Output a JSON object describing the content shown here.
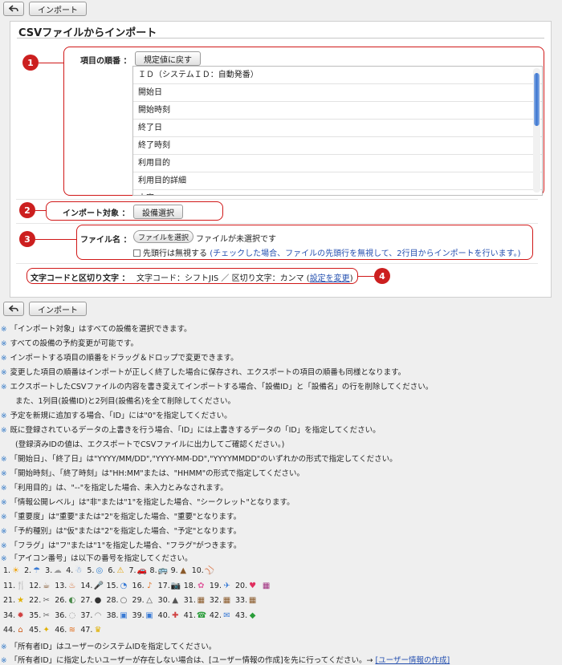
{
  "toolbar_top": {
    "back_icon": "back-arrow-icon",
    "import_label": "インポート"
  },
  "panel": {
    "title": "CSVファイルからインポート",
    "order": {
      "label": "項目の順番 ：",
      "reset_button": "規定値に戻す",
      "items": [
        "ＩＤ（システムＩＤ：自動発番）",
        "開始日",
        "開始時刻",
        "終了日",
        "終了時刻",
        "利用目的",
        "利用目的詳細",
        "内容"
      ]
    },
    "target": {
      "label": "インポート対象 ：",
      "button": "設備選択"
    },
    "file": {
      "label": "ファイル名 ：",
      "choose_button": "ファイルを選択",
      "status": "ファイルが未選択です",
      "checkbox_label": "先頭行は無視する",
      "checkbox_note": "(チェックした場合、ファイルの先頭行を無視して、2行目からインポートを行います。)"
    },
    "encoding": {
      "label": "文字コードと区切り文字 ：",
      "value": "文字コード：シフトJIS ／ 区切り文字：カンマ (",
      "link": "設定を変更",
      "close": ")"
    },
    "badges": [
      "1",
      "2",
      "3",
      "4"
    ]
  },
  "toolbar_bottom": {
    "back_icon": "back-arrow-icon",
    "import_label": "インポート"
  },
  "notes": [
    "「インポート対象」はすべての設備を選択できます。",
    "すべての設備の予約変更が可能です。",
    "インポートする項目の順番をドラッグ＆ドロップで変更できます。",
    "変更した項目の順番はインポートが正しく終了した場合に保存され、エクスポートの項目の順番も同様となります。",
    "エクスポートしたCSVファイルの内容を書き変えてインポートする場合、「設備ID」と「設備名」の行を削除してください。",
    "また、1列目(設備ID)と2列目(設備名)を全て削除してください。",
    "予定を新規に追加する場合、「ID」には\"0\"を指定してください。",
    "既に登録されているデータの上書きを行う場合、「ID」には上書きするデータの「ID」を指定してください。",
    "(登録済みIDの値は、エクスポートでCSVファイルに出力してご確認ください。)",
    "「開始日」、「終了日」は\"YYYY/MM/DD\",\"YYYY-MM-DD\",\"YYYYMMDD\"のいずれかの形式で指定してください。",
    "「開始時刻」、「終了時刻」は\"HH:MM\"または、\"HHMM\"の形式で指定してください。",
    "「利用目的」は、\"--\"を指定した場合、未入力とみなされます。",
    "「情報公開レベル」は\"非\"または\"1\"を指定した場合、\"シークレット\"となります。",
    "「重要度」は\"重要\"または\"2\"を指定した場合、\"重要\"となります。",
    "「予約種別」は\"仮\"または\"2\"を指定した場合、\"予定\"となります。",
    "「フラグ」は\"フ\"または\"1\"を指定した場合、\"フラグ\"がつきます。",
    "「アイコン番号」は以下の番号を指定してください。"
  ],
  "note_mark": "※",
  "icon_rows": [
    [
      {
        "n": "1.",
        "g": "☀",
        "c": "#f0a000"
      },
      {
        "n": "2.",
        "g": "☂",
        "c": "#3a7bd5"
      },
      {
        "n": "3.",
        "g": "☁",
        "c": "#999999"
      },
      {
        "n": "4.",
        "g": "☃",
        "c": "#5a8fd0"
      },
      {
        "n": "5.",
        "g": "◎",
        "c": "#2f7fd0"
      },
      {
        "n": "6.",
        "g": "⚠",
        "c": "#e0a000"
      },
      {
        "n": "7.",
        "g": "🚗",
        "c": "#d03030"
      },
      {
        "n": "8.",
        "g": "🚌",
        "c": "#2a9d3a"
      },
      {
        "n": "9.",
        "g": "▲",
        "c": "#8a5a2a"
      },
      {
        "n": "10.",
        "g": "⚾",
        "c": "#c05030"
      }
    ],
    [
      {
        "n": "11.",
        "g": "🍴",
        "c": "#777777"
      },
      {
        "n": "12.",
        "g": "☕",
        "c": "#7a4a20"
      },
      {
        "n": "13.",
        "g": "♨",
        "c": "#d06020"
      },
      {
        "n": "14.",
        "g": "🎤",
        "c": "#444444"
      },
      {
        "n": "15.",
        "g": "◔",
        "c": "#3a7bd5"
      },
      {
        "n": "16.",
        "g": "♪",
        "c": "#e07020"
      },
      {
        "n": "17.",
        "g": "📷",
        "c": "#333333"
      },
      {
        "n": "18.",
        "g": "✿",
        "c": "#e060a0"
      },
      {
        "n": "19.",
        "g": "✈",
        "c": "#3a7bd5"
      },
      {
        "n": "20.",
        "g": "♥",
        "c": "#e03060"
      },
      {
        "n": "",
        "g": "▦",
        "c": "#a03080"
      }
    ],
    [
      {
        "n": "21.",
        "g": "★",
        "c": "#e0b000"
      },
      {
        "n": "22.",
        "g": "✂",
        "c": "#666666"
      },
      {
        "n": "26.",
        "g": "◐",
        "c": "#4a8a4a"
      },
      {
        "n": "27.",
        "g": "●",
        "c": "#333333"
      },
      {
        "n": "28.",
        "g": "○",
        "c": "#555555"
      },
      {
        "n": "29.",
        "g": "△",
        "c": "#555555"
      },
      {
        "n": "30.",
        "g": "▲",
        "c": "#555555"
      },
      {
        "n": "31.",
        "g": "▦",
        "c": "#8a5a2a"
      },
      {
        "n": "32.",
        "g": "▦",
        "c": "#8a5a2a"
      },
      {
        "n": "33.",
        "g": "▦",
        "c": "#8a5a2a"
      }
    ],
    [
      {
        "n": "34.",
        "g": "✹",
        "c": "#d04040"
      },
      {
        "n": "35.",
        "g": "✂",
        "c": "#666666"
      },
      {
        "n": "36.",
        "g": "◌",
        "c": "#888888"
      },
      {
        "n": "37.",
        "g": "◠",
        "c": "#888888"
      },
      {
        "n": "38.",
        "g": "▣",
        "c": "#3a7bd5"
      },
      {
        "n": "39.",
        "g": "▣",
        "c": "#3a7bd5"
      },
      {
        "n": "40.",
        "g": "✚",
        "c": "#d04040"
      },
      {
        "n": "41.",
        "g": "☎",
        "c": "#2a9d3a"
      },
      {
        "n": "42.",
        "g": "✉",
        "c": "#3a7bd5"
      },
      {
        "n": "43.",
        "g": "◆",
        "c": "#2a9d3a"
      }
    ],
    [
      {
        "n": "44.",
        "g": "⌂",
        "c": "#d06020"
      },
      {
        "n": "45.",
        "g": "✦",
        "c": "#e0b000"
      },
      {
        "n": "46.",
        "g": "≋",
        "c": "#e07020"
      },
      {
        "n": "47.",
        "g": "♛",
        "c": "#e0b000"
      }
    ]
  ],
  "notes_after": [
    "「所有者ID」はユーザーのシステムIDを指定してください。"
  ],
  "last_note": {
    "text": "「所有者ID」に指定したいユーザーが存在しない場合は、[ユーザー情報の作成]を先に行ってください。→",
    "link": "[ユーザー情報の作成]"
  }
}
